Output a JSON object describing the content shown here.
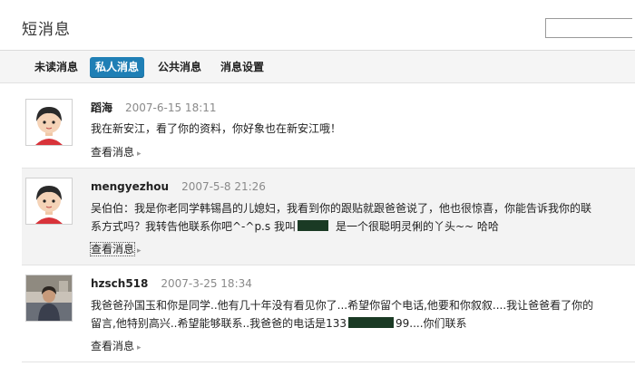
{
  "header": {
    "title": "短消息",
    "search_placeholder": ""
  },
  "tabs": [
    {
      "label": "未读消息",
      "active": false
    },
    {
      "label": "私人消息",
      "active": true
    },
    {
      "label": "公共消息",
      "active": false
    },
    {
      "label": "消息设置",
      "active": false
    }
  ],
  "messages": [
    {
      "sender": "蹈海",
      "time": "2007-6-15 18:11",
      "body": "我在新安江，看了你的资料，你好象也在新安江哦！",
      "link": "查看消息",
      "avatar": "cartoon-avatar"
    },
    {
      "sender": "mengyezhou",
      "time": "2007-5-8 21:26",
      "body_part1": "吴伯伯：我是你老同学韩锡昌的儿媳妇，我看到你的跟贴就跟爸爸说了，他也很惊喜，你能告诉我你的联系方式吗？我转告他联系你吧^-^p.s 我叫",
      "body_part2": "是一个很聪明灵俐的丫头~~ 哈哈",
      "link": "查看消息",
      "avatar": "cartoon-avatar"
    },
    {
      "sender": "hzsch518",
      "time": "2007-3-25 18:34",
      "body_part1": "我爸爸孙国玉和你是同学..他有几十年没有看见你了...希望你留个电话,他要和你叙叙....我让爸爸看了你的留言,他特别高兴..希望能够联系..我爸爸的电话是133",
      "body_part2": "99....你们联系",
      "link": "查看消息",
      "avatar": "photo-avatar"
    }
  ]
}
